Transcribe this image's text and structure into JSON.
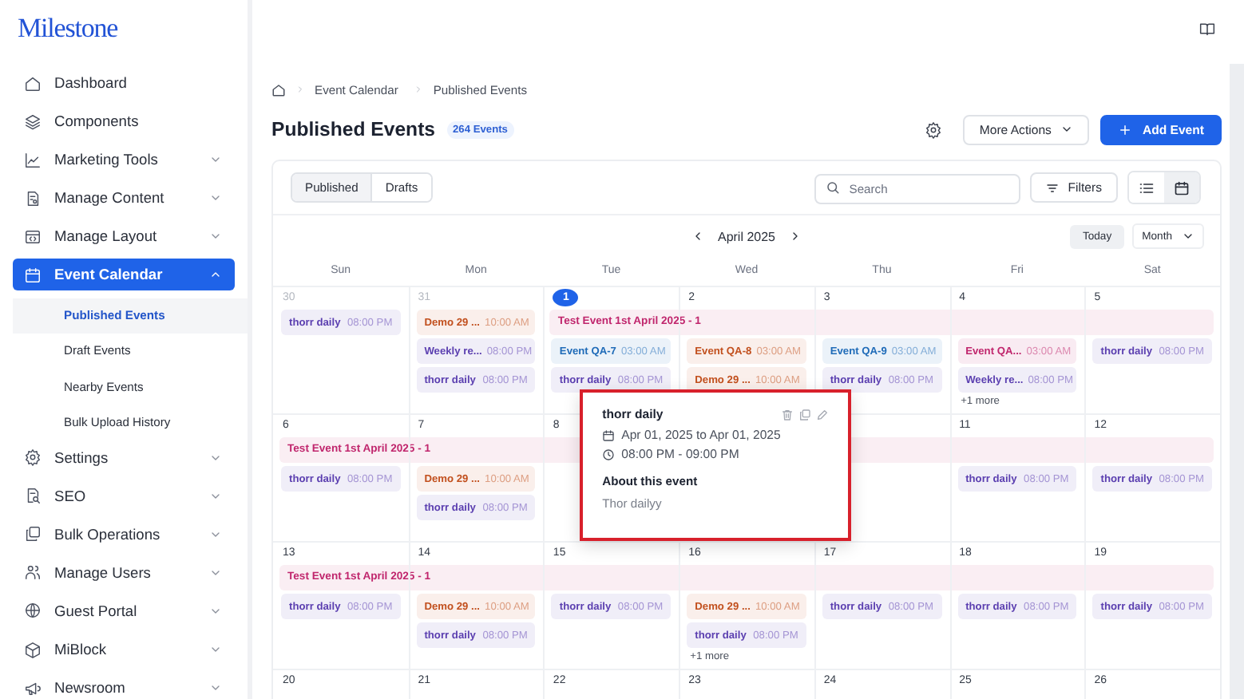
{
  "logo": "Milestone",
  "sidebar": {
    "items": [
      {
        "label": "Dashboard",
        "selected": false
      },
      {
        "label": "Components",
        "selected": false
      },
      {
        "label": "Marketing Tools",
        "selected": false,
        "expanded": false
      },
      {
        "label": "Manage Content",
        "selected": false,
        "expanded": false
      },
      {
        "label": "Manage Layout",
        "selected": false,
        "expanded": false
      },
      {
        "label": "Event Calendar",
        "selected": true,
        "expanded": true,
        "children": [
          {
            "label": "Published Events",
            "selected": true
          },
          {
            "label": "Draft Events",
            "selected": false
          },
          {
            "label": "Nearby Events",
            "selected": false
          },
          {
            "label": "Bulk Upload History",
            "selected": false
          }
        ]
      },
      {
        "label": "Settings",
        "selected": false,
        "expanded": false
      },
      {
        "label": "SEO",
        "selected": false,
        "expanded": false
      },
      {
        "label": "Bulk Operations",
        "selected": false,
        "expanded": false
      },
      {
        "label": "Manage Users",
        "selected": false,
        "expanded": false
      },
      {
        "label": "Guest Portal",
        "selected": false,
        "expanded": false
      },
      {
        "label": "MiBlock",
        "selected": false,
        "expanded": false
      },
      {
        "label": "Newsroom",
        "selected": false,
        "expanded": false
      }
    ]
  },
  "breadcrumb": [
    "Event Calendar",
    "Published Events"
  ],
  "page": {
    "title": "Published Events",
    "count_badge": "264 Events",
    "more_actions": "More Actions",
    "add_button": "Add Event"
  },
  "toolbar": {
    "tabs": [
      {
        "label": "Published",
        "selected": true
      },
      {
        "label": "Drafts",
        "selected": false
      }
    ],
    "search": {
      "placeholder": "Search"
    },
    "filters": "Filters",
    "views": [
      {
        "selected": false
      },
      {
        "selected": true
      }
    ]
  },
  "calendar": {
    "month_label": "April 2025",
    "today_button": "Today",
    "view_select": "Month",
    "weekdays": [
      "Sun",
      "Mon",
      "Tue",
      "Wed",
      "Thu",
      "Fri",
      "Sat"
    ],
    "weeks": [
      {
        "days": [
          {
            "date": "30",
            "outside": true,
            "today": false,
            "events": [
              {
                "title": "thorr daily",
                "time": "08:00 PM",
                "color": "#5b3fb0"
              }
            ]
          },
          {
            "date": "31",
            "outside": true,
            "today": false,
            "events": [
              {
                "title": "Demo 29 ...",
                "time": "10:00 AM",
                "color": "#c2501e"
              },
              {
                "title": "Weekly re...",
                "time": "08:00 PM",
                "color": "#5b3fb0"
              },
              {
                "title": "thorr daily",
                "time": "08:00 PM",
                "color": "#5b3fb0"
              }
            ]
          },
          {
            "date": "1",
            "outside": false,
            "today": true,
            "band": {
              "label": "Test Event 1st April 2025 - 1",
              "color": "#c0266d"
            },
            "events": [
              {
                "title": "Event QA-7",
                "time": "03:00 AM",
                "color": "#1f6bb8"
              },
              {
                "title": "thorr daily",
                "time": "08:00 PM",
                "color": "#5b3fb0"
              }
            ]
          },
          {
            "date": "2",
            "outside": false,
            "today": false,
            "events": [
              {
                "title": "Event QA-8",
                "time": "03:00 AM",
                "color": "#c2501e"
              },
              {
                "title": "Demo 29 ...",
                "time": "10:00 AM",
                "color": "#c2501e"
              }
            ]
          },
          {
            "date": "3",
            "outside": false,
            "today": false,
            "events": [
              {
                "title": "Event QA-9",
                "time": "03:00 AM",
                "color": "#1f6bb8"
              },
              {
                "title": "thorr daily",
                "time": "08:00 PM",
                "color": "#5b3fb0"
              }
            ]
          },
          {
            "date": "4",
            "outside": false,
            "today": false,
            "events": [
              {
                "title": "Event QA...",
                "time": "03:00 AM",
                "color": "#c0266d"
              },
              {
                "title": "Weekly re...",
                "time": "08:00 PM",
                "color": "#5b3fb0"
              }
            ],
            "more": "+1 more"
          },
          {
            "date": "5",
            "outside": false,
            "today": false,
            "events": [
              {
                "title": "thorr daily",
                "time": "08:00 PM",
                "color": "#5b3fb0"
              }
            ]
          }
        ]
      },
      {
        "days": [
          {
            "date": "6",
            "outside": false,
            "today": false,
            "band": {
              "label": "Test Event 1st April 2025 - 1",
              "color": "#c0266d"
            },
            "events": [
              {
                "title": "thorr daily",
                "time": "08:00 PM",
                "color": "#5b3fb0"
              }
            ]
          },
          {
            "date": "7",
            "outside": false,
            "today": false,
            "events": [
              {
                "title": "Demo 29 ...",
                "time": "10:00 AM",
                "color": "#c2501e"
              },
              {
                "title": "thorr daily",
                "time": "08:00 PM",
                "color": "#5b3fb0"
              }
            ]
          },
          {
            "date": "8",
            "outside": false,
            "today": false
          },
          {
            "kind": "popover"
          },
          {
            "kind": "popover"
          },
          {
            "date": "11",
            "outside": false,
            "today": false,
            "events": [
              {
                "title": "thorr daily",
                "time": "08:00 PM",
                "color": "#5b3fb0"
              }
            ]
          },
          {
            "date": "12",
            "outside": false,
            "today": false,
            "events": [
              {
                "title": "thorr daily",
                "time": "08:00 PM",
                "color": "#5b3fb0"
              }
            ]
          }
        ]
      },
      {
        "days": [
          {
            "date": "13",
            "outside": false,
            "today": false,
            "band": {
              "label": "Test Event 1st April 2025 - 1",
              "color": "#c0266d"
            },
            "events": [
              {
                "title": "thorr daily",
                "time": "08:00 PM",
                "color": "#5b3fb0"
              }
            ]
          },
          {
            "date": "14",
            "outside": false,
            "today": false,
            "events": [
              {
                "title": "Demo 29 ...",
                "time": "10:00 AM",
                "color": "#c2501e"
              },
              {
                "title": "thorr daily",
                "time": "08:00 PM",
                "color": "#5b3fb0"
              }
            ]
          },
          {
            "date": "15",
            "outside": false,
            "today": false,
            "events": [
              {
                "title": "thorr daily",
                "time": "08:00 PM",
                "color": "#5b3fb0"
              }
            ]
          },
          {
            "date": "16",
            "outside": false,
            "today": false,
            "events": [
              {
                "title": "Demo 29 ...",
                "time": "10:00 AM",
                "color": "#c2501e"
              },
              {
                "title": "thorr daily",
                "time": "08:00 PM",
                "color": "#5b3fb0"
              }
            ],
            "more": "+1 more"
          },
          {
            "date": "17",
            "outside": false,
            "today": false,
            "events": [
              {
                "title": "thorr daily",
                "time": "08:00 PM",
                "color": "#5b3fb0"
              }
            ]
          },
          {
            "date": "18",
            "outside": false,
            "today": false,
            "events": [
              {
                "title": "thorr daily",
                "time": "08:00 PM",
                "color": "#5b3fb0"
              }
            ]
          },
          {
            "date": "19",
            "outside": false,
            "today": false,
            "events": [
              {
                "title": "thorr daily",
                "time": "08:00 PM",
                "color": "#5b3fb0"
              }
            ]
          }
        ]
      },
      {
        "days": [
          {
            "date": "20",
            "outside": false,
            "today": false
          },
          {
            "date": "21",
            "outside": false,
            "today": false
          },
          {
            "date": "22",
            "outside": false,
            "today": false
          },
          {
            "date": "23",
            "outside": false,
            "today": false
          },
          {
            "date": "24",
            "outside": false,
            "today": false
          },
          {
            "date": "25",
            "outside": false,
            "today": false
          },
          {
            "date": "26",
            "outside": false,
            "today": false
          }
        ]
      }
    ]
  },
  "popover": {
    "title": "thorr daily",
    "date_range": "Apr 01, 2025 to Apr 01, 2025",
    "time_range": "08:00 PM - 09:00 PM",
    "about_heading": "About this event",
    "description": "Thor dailyy"
  }
}
